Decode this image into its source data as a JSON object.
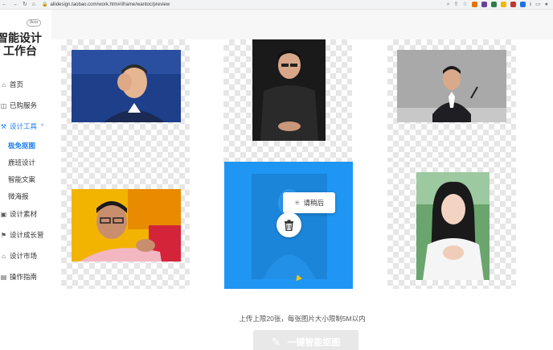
{
  "browser": {
    "url": "aliidesign.taobao.com/work.htm#/iframe/wantoc/preview",
    "nav": [
      "←",
      "→",
      "↻",
      "⌂"
    ]
  },
  "sidebar": {
    "beta": "Beta",
    "logo_line1": "智能设计",
    "logo_line2": "工作台",
    "items": [
      {
        "label": "首页",
        "icon": "home-icon"
      },
      {
        "label": "已购服务",
        "icon": "bag-icon"
      },
      {
        "label": "设计工具",
        "icon": "tools-icon"
      },
      {
        "label": "设计素材",
        "icon": "image-icon"
      },
      {
        "label": "设计成长营",
        "icon": "flag-icon"
      },
      {
        "label": "设计市场",
        "icon": "shop-icon"
      },
      {
        "label": "操作指南",
        "icon": "book-icon"
      }
    ],
    "subitems": [
      {
        "label": "极免抠图"
      },
      {
        "label": "鹿班设计"
      },
      {
        "label": "智能文案"
      },
      {
        "label": "微海报"
      }
    ]
  },
  "main": {
    "loading_text": "请稍后",
    "hint": "上传上限20张，每张图片大小限制5M以内",
    "cta_label": "一键智能抠图"
  },
  "colors": {
    "accent": "#1a7cf5",
    "selected_card": "#1f96f3"
  }
}
